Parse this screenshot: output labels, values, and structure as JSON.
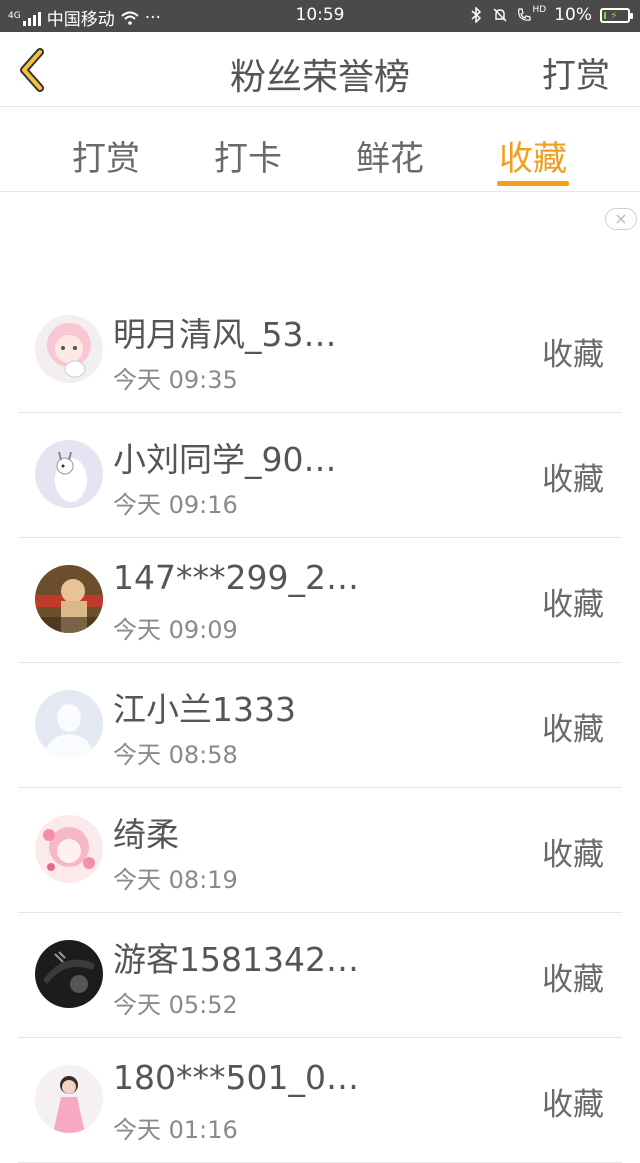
{
  "status_bar": {
    "network_label": "4G",
    "carrier": "中国移动",
    "more": "···",
    "time": "10:59",
    "hd_label": "HD",
    "battery": "10%",
    "battery_level": 0.1
  },
  "nav": {
    "title": "粉丝荣誉榜",
    "right_action": "打赏"
  },
  "tabs": [
    {
      "label": "打赏",
      "active": false
    },
    {
      "label": "打卡",
      "active": false
    },
    {
      "label": "鲜花",
      "active": false
    },
    {
      "label": "收藏",
      "active": true
    }
  ],
  "close_icon": "×",
  "accent_color": "#f0a01d",
  "list": [
    {
      "name": "明月清风_53…",
      "time": "今天 09:35",
      "action": "收藏",
      "avatar": "anime-girl-pink"
    },
    {
      "name": "小刘同学_90…",
      "time": "今天 09:16",
      "action": "收藏",
      "avatar": "cartoon-cow"
    },
    {
      "name": "147***299_2…",
      "time": "今天 09:09",
      "action": "收藏",
      "avatar": "photo-person-red"
    },
    {
      "name": "江小兰1333",
      "time": "今天 08:58",
      "action": "收藏",
      "avatar": "default-silhouette"
    },
    {
      "name": "绮柔",
      "time": "今天 08:19",
      "action": "收藏",
      "avatar": "anime-girl-flowers"
    },
    {
      "name": "游客1581342…",
      "time": "今天 05:52",
      "action": "收藏",
      "avatar": "dark-photo"
    },
    {
      "name": "180***501_0…",
      "time": "今天 01:16",
      "action": "收藏",
      "avatar": "girl-pink-dress"
    }
  ]
}
